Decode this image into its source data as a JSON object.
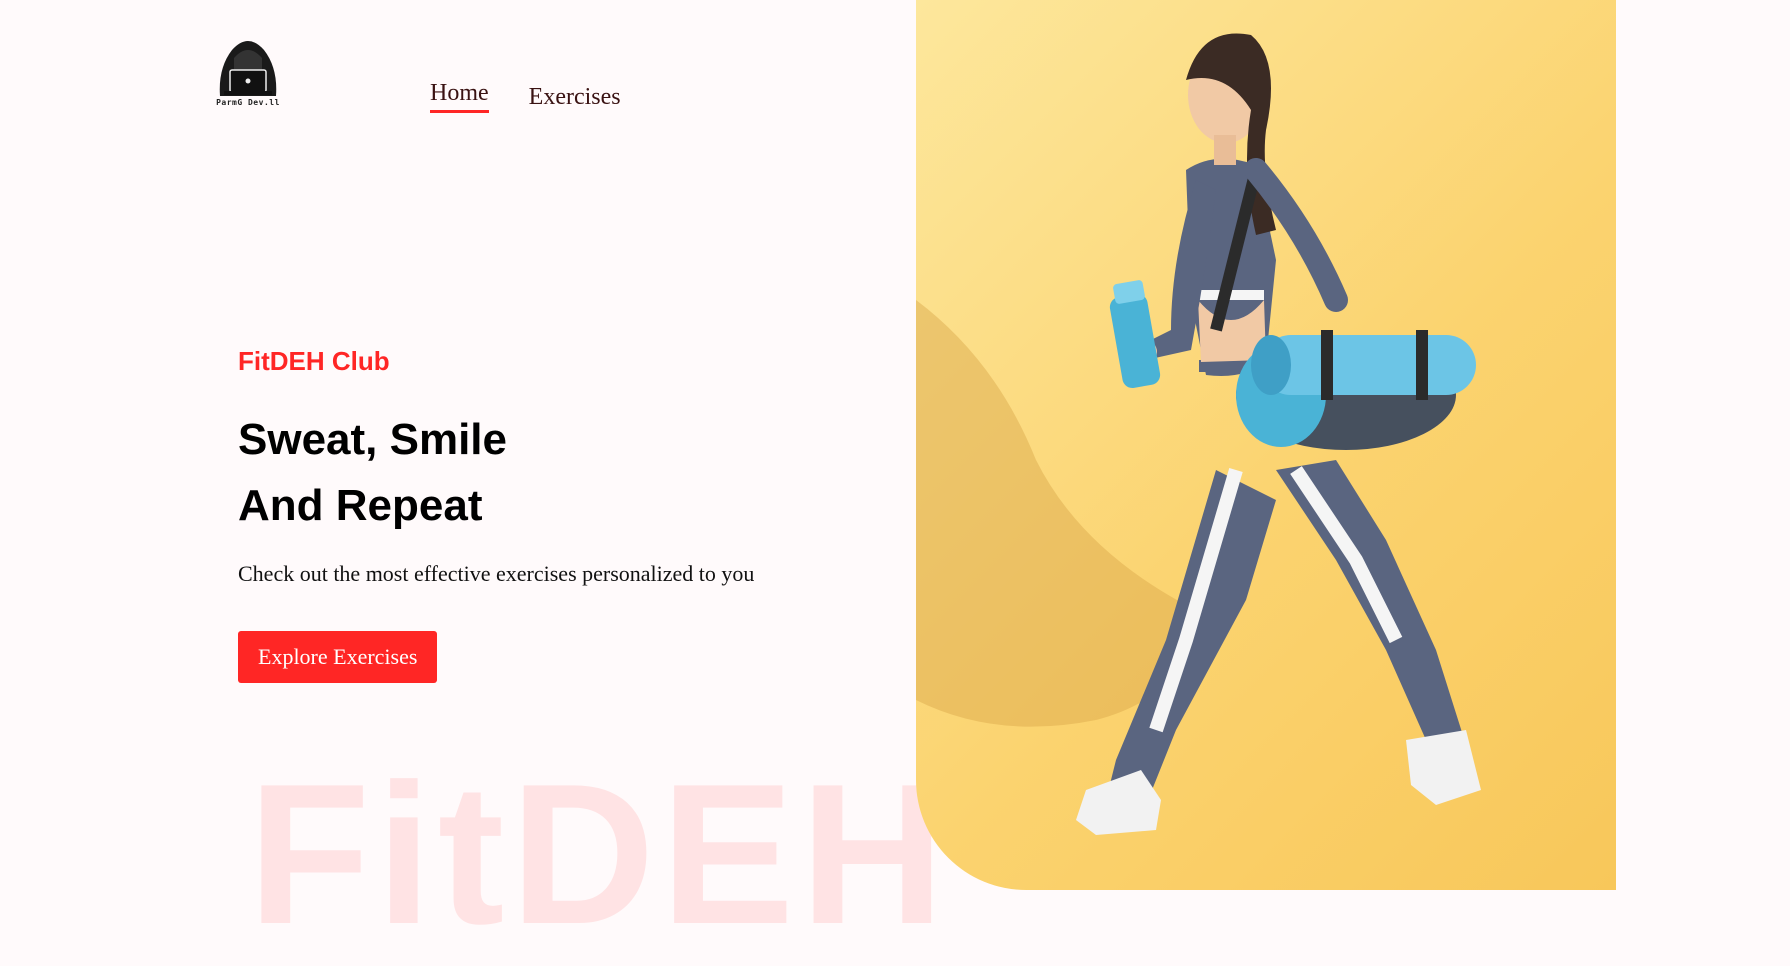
{
  "logo": {
    "text": "ParmG Dev.ll"
  },
  "nav": {
    "home": "Home",
    "exercises": "Exercises"
  },
  "hero": {
    "brand": "FitDEH Club",
    "headline_line1": "Sweat, Smile",
    "headline_line2": "And Repeat",
    "description": "Check out the most effective exercises personalized to you",
    "cta": "Explore Exercises"
  },
  "watermark": "FitDEH",
  "colors": {
    "accent": "#ff2625",
    "background": "#fffafb",
    "banner": "#fbd36f"
  },
  "banner_image": "fitness-woman-walking-with-yoga-mat-and-shaker"
}
